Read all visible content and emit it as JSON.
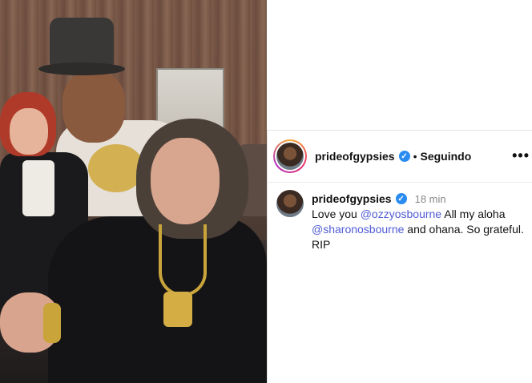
{
  "post": {
    "header": {
      "username": "prideofgypsies",
      "separator": "•",
      "follow_label": "Seguindo",
      "more_label": "•••",
      "verified_icon": "verified-check-icon"
    },
    "comment": {
      "username": "prideofgypsies",
      "time": "18 min",
      "text_1": "Love you ",
      "mention_1": "@ozzyosbourne",
      "text_2": "  All my aloha ",
      "mention_2": "@sharonosbourne",
      "text_3": " and ohana.  So grateful. RIP"
    }
  },
  "colors": {
    "mention": "#4f5bd5",
    "verified": "#2a8cf0"
  }
}
